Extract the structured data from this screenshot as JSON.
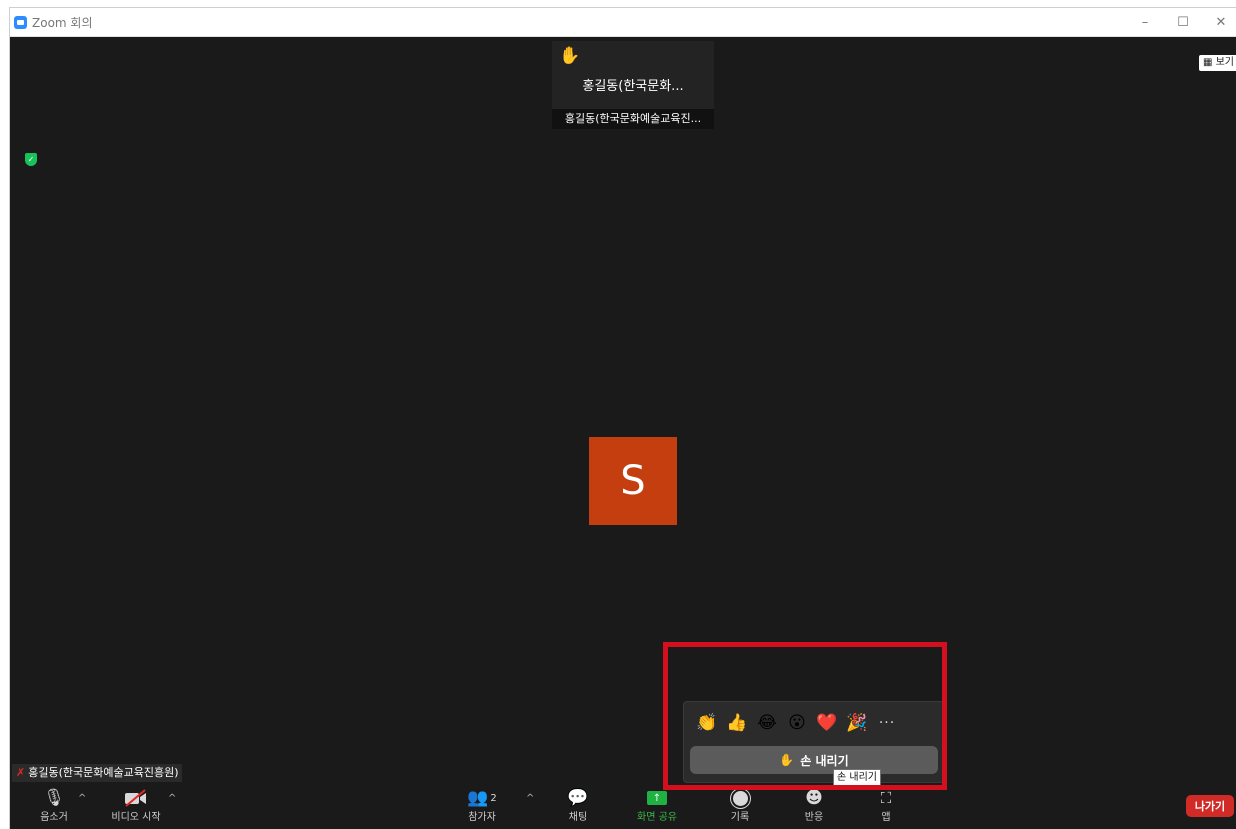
{
  "window": {
    "title": "Zoom 회의",
    "controls": {
      "minimize": "–",
      "maximize": "☐",
      "close": "✕"
    }
  },
  "top_bar": {
    "view_label": "보기"
  },
  "active_thumbnail": {
    "display_name": "홍길동(한국문화...",
    "label": "홍길동(한국문화예술교육진..."
  },
  "main_video": {
    "avatar_initial": "S"
  },
  "name_tag": {
    "text": "홍길동(한국문화예술교육진흥원)"
  },
  "reactions_popup": {
    "emojis": [
      "👏",
      "👍",
      "😂",
      "😮",
      "❤️",
      "🎉"
    ],
    "more_label": "···",
    "lower_hand_label": "손 내리기",
    "tooltip": "손 내리기"
  },
  "toolbar": {
    "mute_label": "음소거",
    "video_label": "비디오 시작",
    "participants_label": "참가자",
    "participants_count": "2",
    "chat_label": "채팅",
    "share_label": "화면 공유",
    "record_label": "기록",
    "reactions_label": "반응",
    "apps_label": "앱",
    "leave_label": "나가기"
  },
  "colors": {
    "background": "#1a1a1a",
    "avatar": "#c43e10",
    "share_green": "#1fb141",
    "leave_red": "#d12b27",
    "highlight_red": "#d4101e"
  }
}
